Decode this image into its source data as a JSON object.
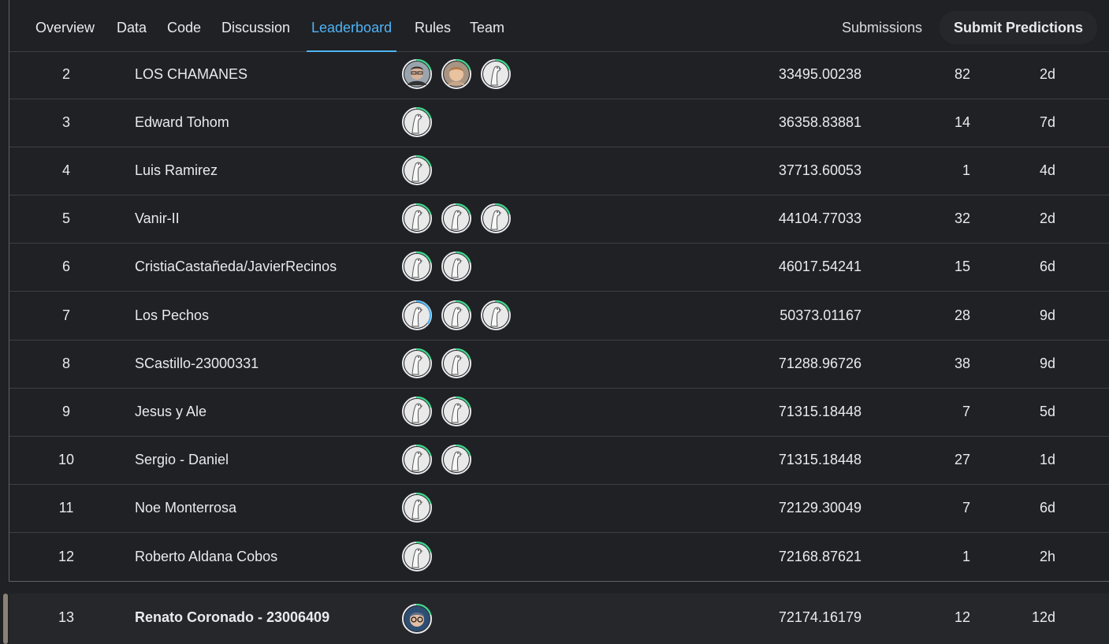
{
  "nav": {
    "tabs": [
      "Overview",
      "Data",
      "Code",
      "Discussion",
      "Leaderboard",
      "Rules",
      "Team"
    ],
    "active_tab": "Leaderboard",
    "submissions_label": "Submissions",
    "submit_label": "Submit Predictions"
  },
  "colors": {
    "accent": "#4fb3f6",
    "ring_green": "#3dd68c",
    "ring_blue": "#4fb3f6",
    "background": "#202124"
  },
  "leaderboard": {
    "rows": [
      {
        "rank": "2",
        "team": "LOS CHAMANES",
        "avatars": [
          "photo-man-glasses",
          "photo-child",
          "default-goose"
        ],
        "score": "33495.00238",
        "entries": "82",
        "last": "2d"
      },
      {
        "rank": "3",
        "team": "Edward Tohom",
        "avatars": [
          "default-goose"
        ],
        "score": "36358.83881",
        "entries": "14",
        "last": "7d"
      },
      {
        "rank": "4",
        "team": "Luis Ramirez",
        "avatars": [
          "default-goose"
        ],
        "score": "37713.60053",
        "entries": "1",
        "last": "4d"
      },
      {
        "rank": "5",
        "team": "Vanir-II",
        "avatars": [
          "default-goose",
          "default-goose",
          "default-goose"
        ],
        "score": "44104.77033",
        "entries": "32",
        "last": "2d"
      },
      {
        "rank": "6",
        "team": "CristiaCastañeda/JavierRecinos",
        "avatars": [
          "default-goose",
          "default-goose"
        ],
        "score": "46017.54241",
        "entries": "15",
        "last": "6d"
      },
      {
        "rank": "7",
        "team": "Los Pechos",
        "avatars": [
          "default-goose-blue",
          "default-goose",
          "default-goose"
        ],
        "score": "50373.01167",
        "entries": "28",
        "last": "9d"
      },
      {
        "rank": "8",
        "team": "SCastillo-23000331",
        "avatars": [
          "default-goose",
          "default-goose"
        ],
        "score": "71288.96726",
        "entries": "38",
        "last": "9d"
      },
      {
        "rank": "9",
        "team": "Jesus y Ale",
        "avatars": [
          "default-goose",
          "default-goose"
        ],
        "score": "71315.18448",
        "entries": "7",
        "last": "5d"
      },
      {
        "rank": "10",
        "team": "Sergio - Daniel",
        "avatars": [
          "default-goose",
          "default-goose"
        ],
        "score": "71315.18448",
        "entries": "27",
        "last": "1d"
      },
      {
        "rank": "11",
        "team": "Noe Monterrosa",
        "avatars": [
          "default-goose"
        ],
        "score": "72129.30049",
        "entries": "7",
        "last": "6d"
      },
      {
        "rank": "12",
        "team": "Roberto Aldana Cobos",
        "avatars": [
          "default-goose"
        ],
        "score": "72168.87621",
        "entries": "1",
        "last": "2h"
      }
    ],
    "own_row": {
      "rank": "13",
      "team": "Renato Coronado - 23006409",
      "avatars": [
        "avatar-glasses-blue"
      ],
      "score": "72174.16179",
      "entries": "12",
      "last": "12d"
    }
  }
}
